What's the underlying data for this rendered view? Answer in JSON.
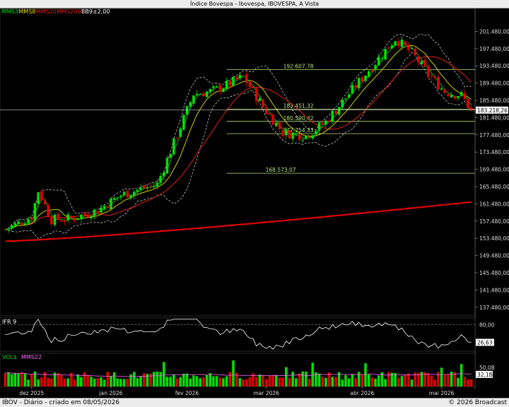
{
  "window": {
    "title": "Índice Bovespa - Ibovespa, IBOVESPA, A Vista",
    "footer_left": "IBOV - Diário - criado em 08/05/2026",
    "footer_right": "© 2026 Broadcast"
  },
  "legend": [
    {
      "label": "MMS3",
      "color": "#00e000"
    },
    {
      "label": "MMS8",
      "color": "#e6e600"
    },
    {
      "label": "MMS20",
      "color": "#e02020"
    },
    {
      "label": "MMS200",
      "color": "#e02020"
    },
    {
      "label": "BB9±2,00",
      "color": "#ffffff"
    }
  ],
  "colors": {
    "up": "#00e000",
    "down": "#e00000",
    "mms200": "#e00000",
    "fib": "#b8e07a",
    "band": "#dddddd"
  },
  "chart_data": [
    {
      "type": "candlestick",
      "title": "Índice Bovespa - Ibovespa, IBOVESPA, A Vista",
      "ylim": [
        135480,
        205480
      ],
      "y_ticks": [
        "201.480,00",
        "197.480,00",
        "193.480,00",
        "189.480,00",
        "185.480,00",
        "181.480,00",
        "177.480,00",
        "173.480,00",
        "169.480,00",
        "165.480,00",
        "161.480,00",
        "157.480,00",
        "153.480,00",
        "149.480,00",
        "145.480,00",
        "141.480,00",
        "137.480,00"
      ],
      "last_price": 183218.26,
      "last_price_label": "183.218,26",
      "x_labels": [
        {
          "label": "dez 2025",
          "index": 8
        },
        {
          "label": "jan 2026",
          "index": 32
        },
        {
          "label": "fev 2026",
          "index": 55
        },
        {
          "label": "mar 2026",
          "index": 79
        },
        {
          "label": "abr 2026",
          "index": 108
        },
        {
          "label": "mai 2026",
          "index": 132
        }
      ],
      "fib_levels": [
        {
          "value": 192607.78,
          "label": "192.607,78"
        },
        {
          "value": 183451.32,
          "label": "183.451,32"
        },
        {
          "value": 180590.42,
          "label": "180.590,42"
        },
        {
          "value": 177754.33,
          "label": "177.754,33"
        },
        {
          "value": 168573.07,
          "label": "168.573,07"
        }
      ],
      "fib_start_index": 67,
      "mms200_start": 152800,
      "mms200_end": 161900
    },
    {
      "type": "line",
      "title": "IFR 9",
      "ylim": [
        0,
        100
      ],
      "reference_label": "80,00",
      "reference_value": 80,
      "last_label": "26,63",
      "last_value": 26.63
    },
    {
      "type": "bar",
      "title": "VOL$",
      "subtitle": "MMS22",
      "reference_label": "50,0B",
      "last_label": "32,1B"
    }
  ]
}
